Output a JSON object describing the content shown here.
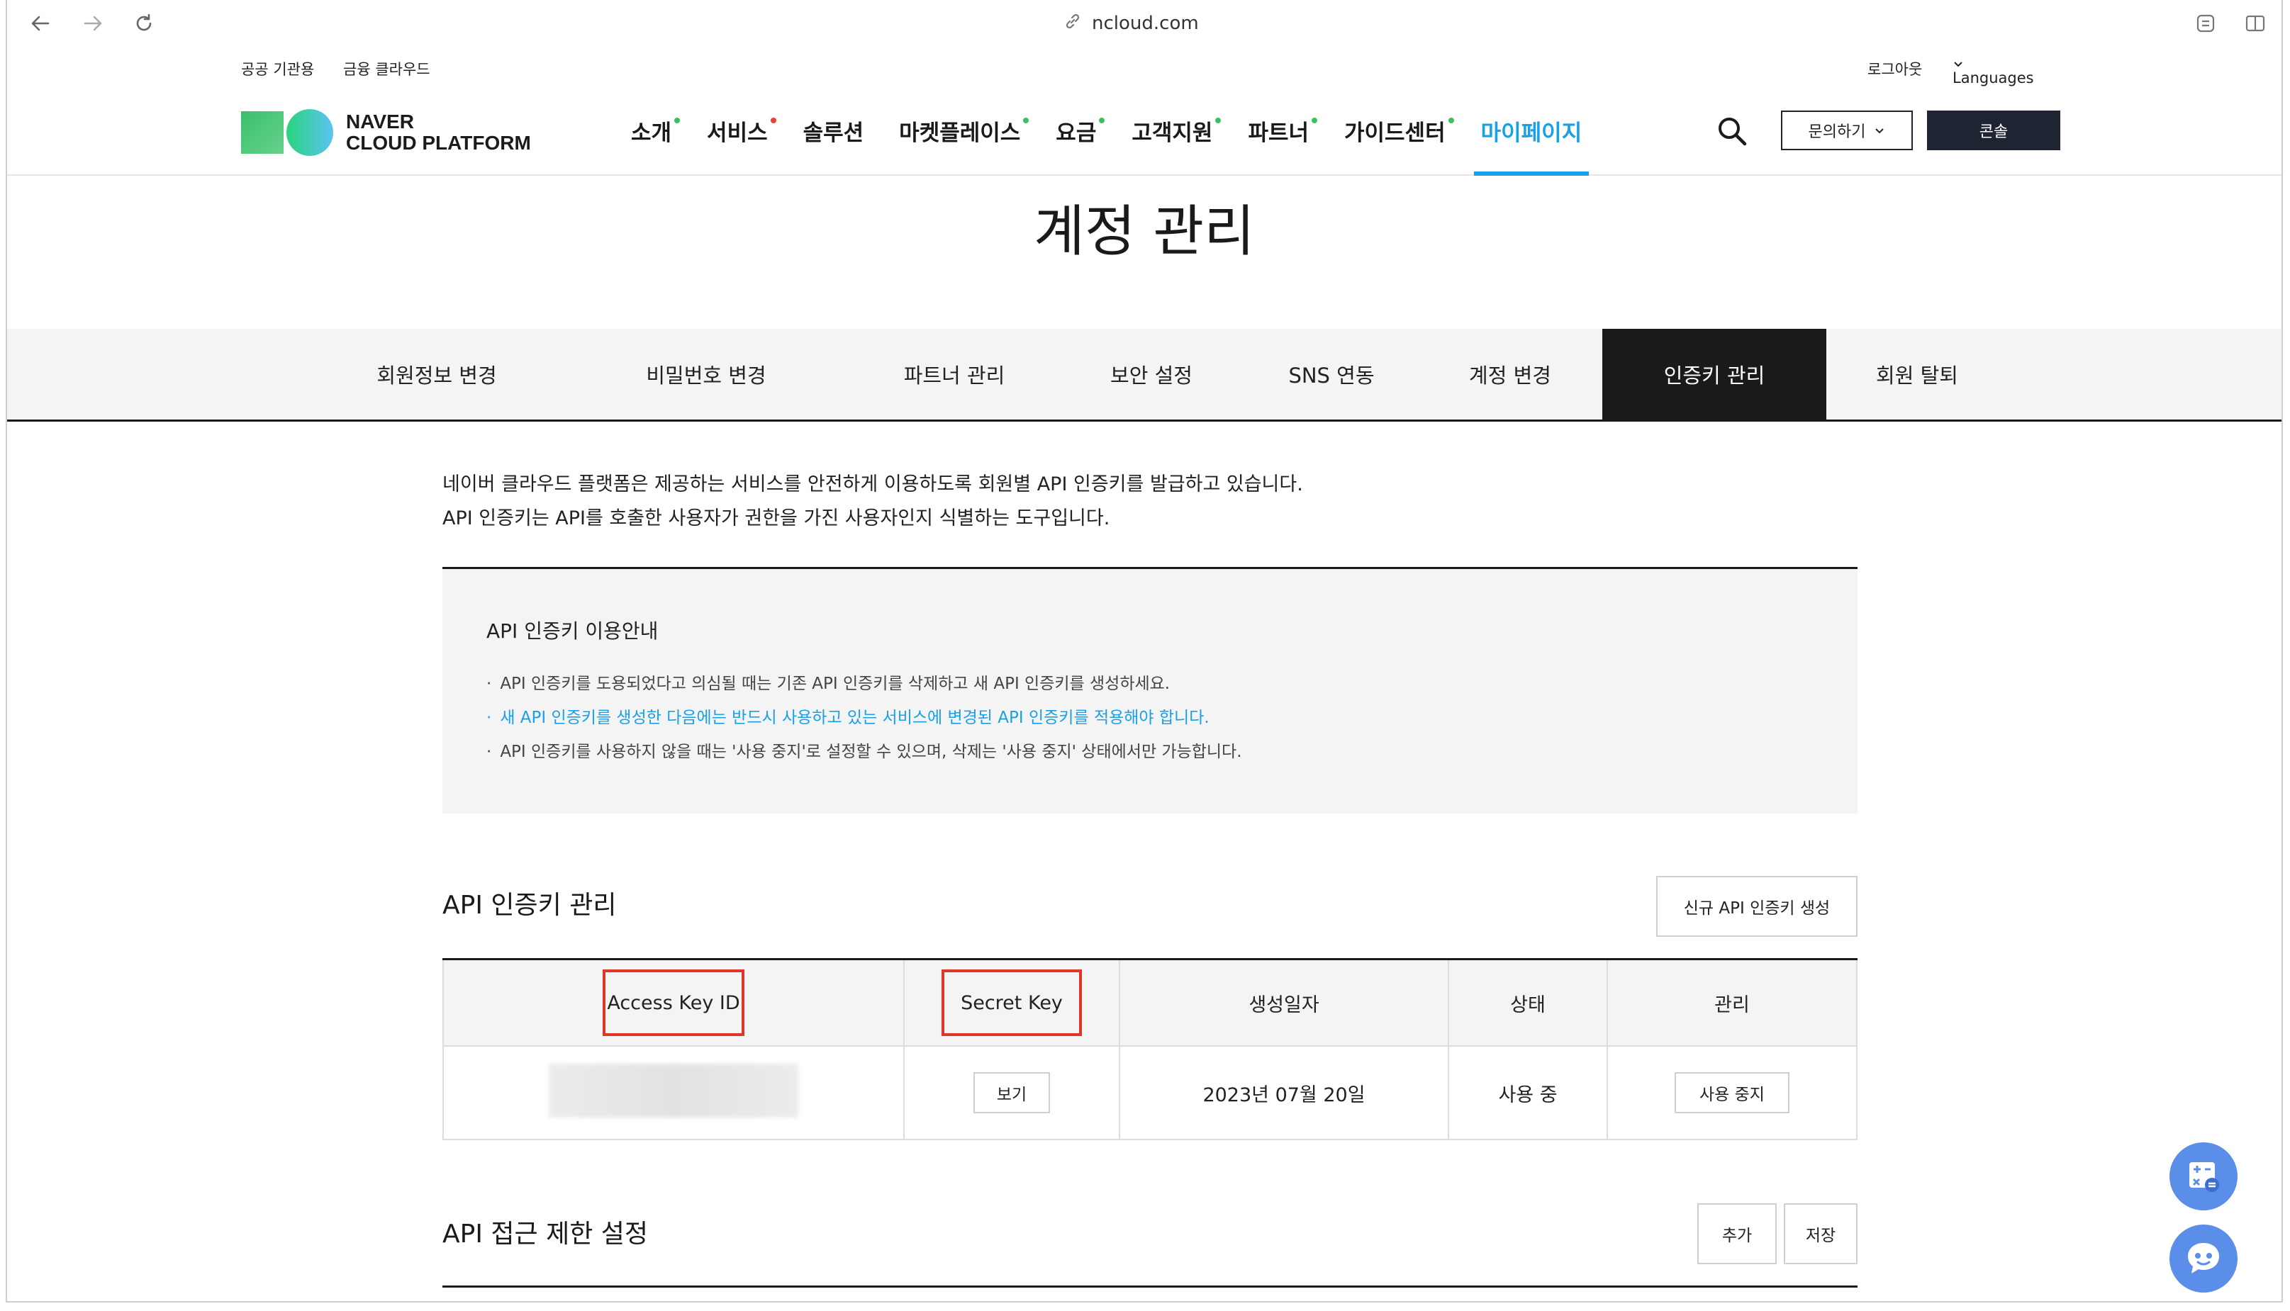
{
  "browser": {
    "url": "ncloud.com"
  },
  "utility": {
    "public": "공공 기관용",
    "finance": "금융 클라우드",
    "logout": "로그아웃",
    "languages": "Languages"
  },
  "logo": {
    "line1": "NAVER",
    "line2": "CLOUD PLATFORM"
  },
  "nav": [
    {
      "label": "소개",
      "dot": "#3cbf5e"
    },
    {
      "label": "서비스",
      "dot": "#e8423a"
    },
    {
      "label": "솔루션",
      "dot": ""
    },
    {
      "label": "마켓플레이스",
      "dot": "#3cbf5e"
    },
    {
      "label": "요금",
      "dot": "#3cbf5e"
    },
    {
      "label": "고객지원",
      "dot": "#3cbf5e"
    },
    {
      "label": "파트너",
      "dot": "#3cbf5e"
    },
    {
      "label": "가이드센터",
      "dot": "#3cbf5e"
    },
    {
      "label": "마이페이지",
      "dot": ""
    }
  ],
  "header_buttons": {
    "inquiry": "문의하기",
    "console": "콘솔"
  },
  "page_title": "계정 관리",
  "tabs": [
    "회원정보 변경",
    "비밀번호 변경",
    "파트너 관리",
    "보안 설정",
    "SNS 연동",
    "계정 변경",
    "인증키 관리",
    "회원 탈퇴"
  ],
  "intro": [
    "네이버 클라우드 플랫폼은 제공하는 서비스를 안전하게 이용하도록 회원별 API 인증키를 발급하고 있습니다.",
    "API 인증키는 API를 호출한 사용자가 권한을 가진 사용자인지 식별하는 도구입니다."
  ],
  "notice": {
    "title": "API 인증키 이용안내",
    "items": [
      "API 인증키를 도용되었다고 의심될 때는 기존 API 인증키를 삭제하고 새 API 인증키를 생성하세요.",
      "새 API 인증키를 생성한 다음에는 반드시 사용하고 있는 서비스에 변경된 API 인증키를 적용해야 합니다.",
      "API 인증키를 사용하지 않을 때는 '사용 중지'로 설정할 수 있으며, 삭제는 '사용 중지' 상태에서만 가능합니다."
    ]
  },
  "key_section": {
    "title": "API 인증키 관리",
    "create_button": "신규 API 인증키 생성",
    "columns": [
      "Access Key ID",
      "Secret Key",
      "생성일자",
      "상태",
      "관리"
    ],
    "row": {
      "secret_button": "보기",
      "created": "2023년 07월 20일",
      "status": "사용 중",
      "manage_button": "사용 중지"
    }
  },
  "access_section": {
    "title": "API 접근 제한 설정",
    "add_button": "추가",
    "save_button": "저장"
  }
}
